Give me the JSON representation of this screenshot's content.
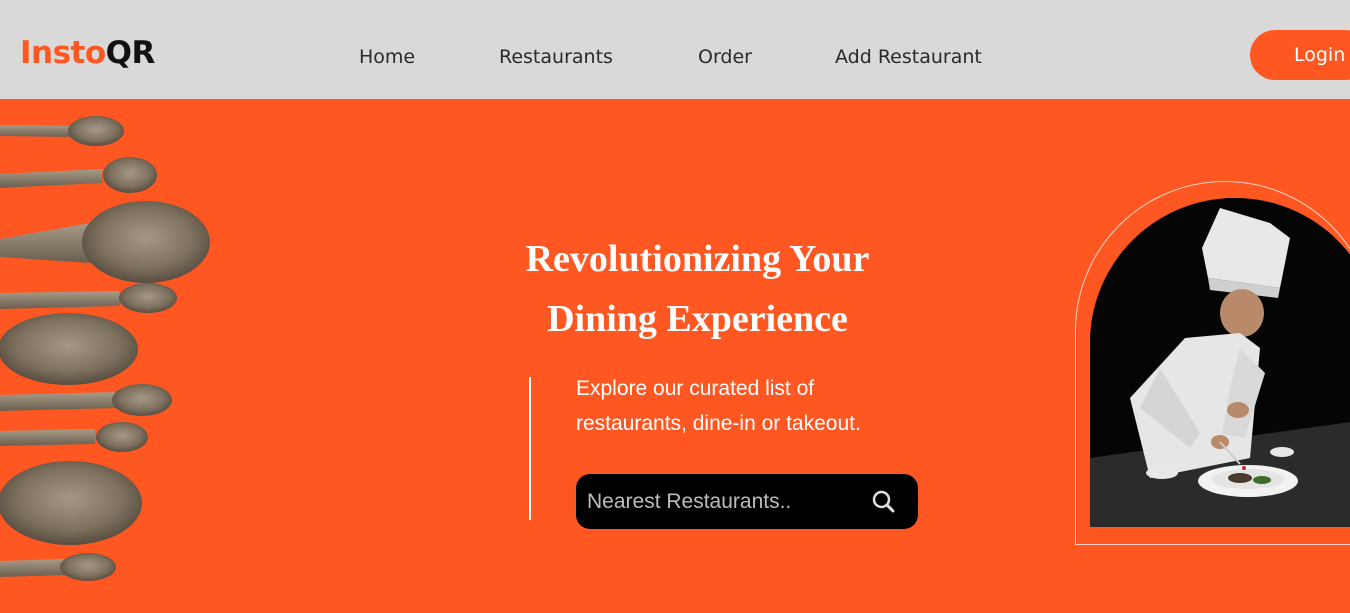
{
  "brand": {
    "logo_part1": "Insto",
    "logo_part2": "QR",
    "accent_color": "#ff5722",
    "header_bg": "#d9d9d9"
  },
  "nav": {
    "items": [
      {
        "label": "Home"
      },
      {
        "label": "Restaurants"
      },
      {
        "label": "Order"
      },
      {
        "label": "Add Restaurant"
      }
    ],
    "login_label": "Login"
  },
  "hero": {
    "headline_line1": "Revolutionizing Your",
    "headline_line2": "Dining Experience",
    "description_line1": "Explore our curated list of",
    "description_line2": "restaurants, dine-in or takeout.",
    "search_placeholder": "Nearest Restaurants..",
    "search_value": "",
    "search_icon": "search-icon",
    "left_image": "wooden-spoons-image",
    "right_image": "chef-plating-image"
  }
}
